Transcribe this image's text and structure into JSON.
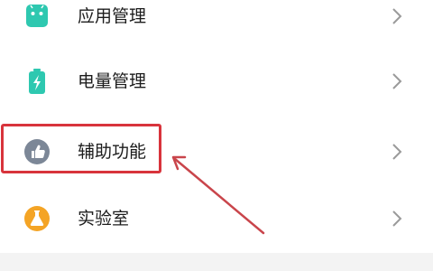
{
  "settings": {
    "items": [
      {
        "label": "应用管理",
        "icon": "android-icon",
        "icon_color": "#2ec8b0"
      },
      {
        "label": "电量管理",
        "icon": "battery-icon",
        "icon_color": "#2ec8b0"
      },
      {
        "label": "辅助功能",
        "icon": "thumbs-up-icon",
        "icon_color": "#7c8797"
      },
      {
        "label": "实验室",
        "icon": "flask-icon",
        "icon_color": "#f4a425"
      }
    ]
  },
  "annotation": {
    "highlight_color": "#d8343c",
    "arrow_color": "#c9454b"
  }
}
